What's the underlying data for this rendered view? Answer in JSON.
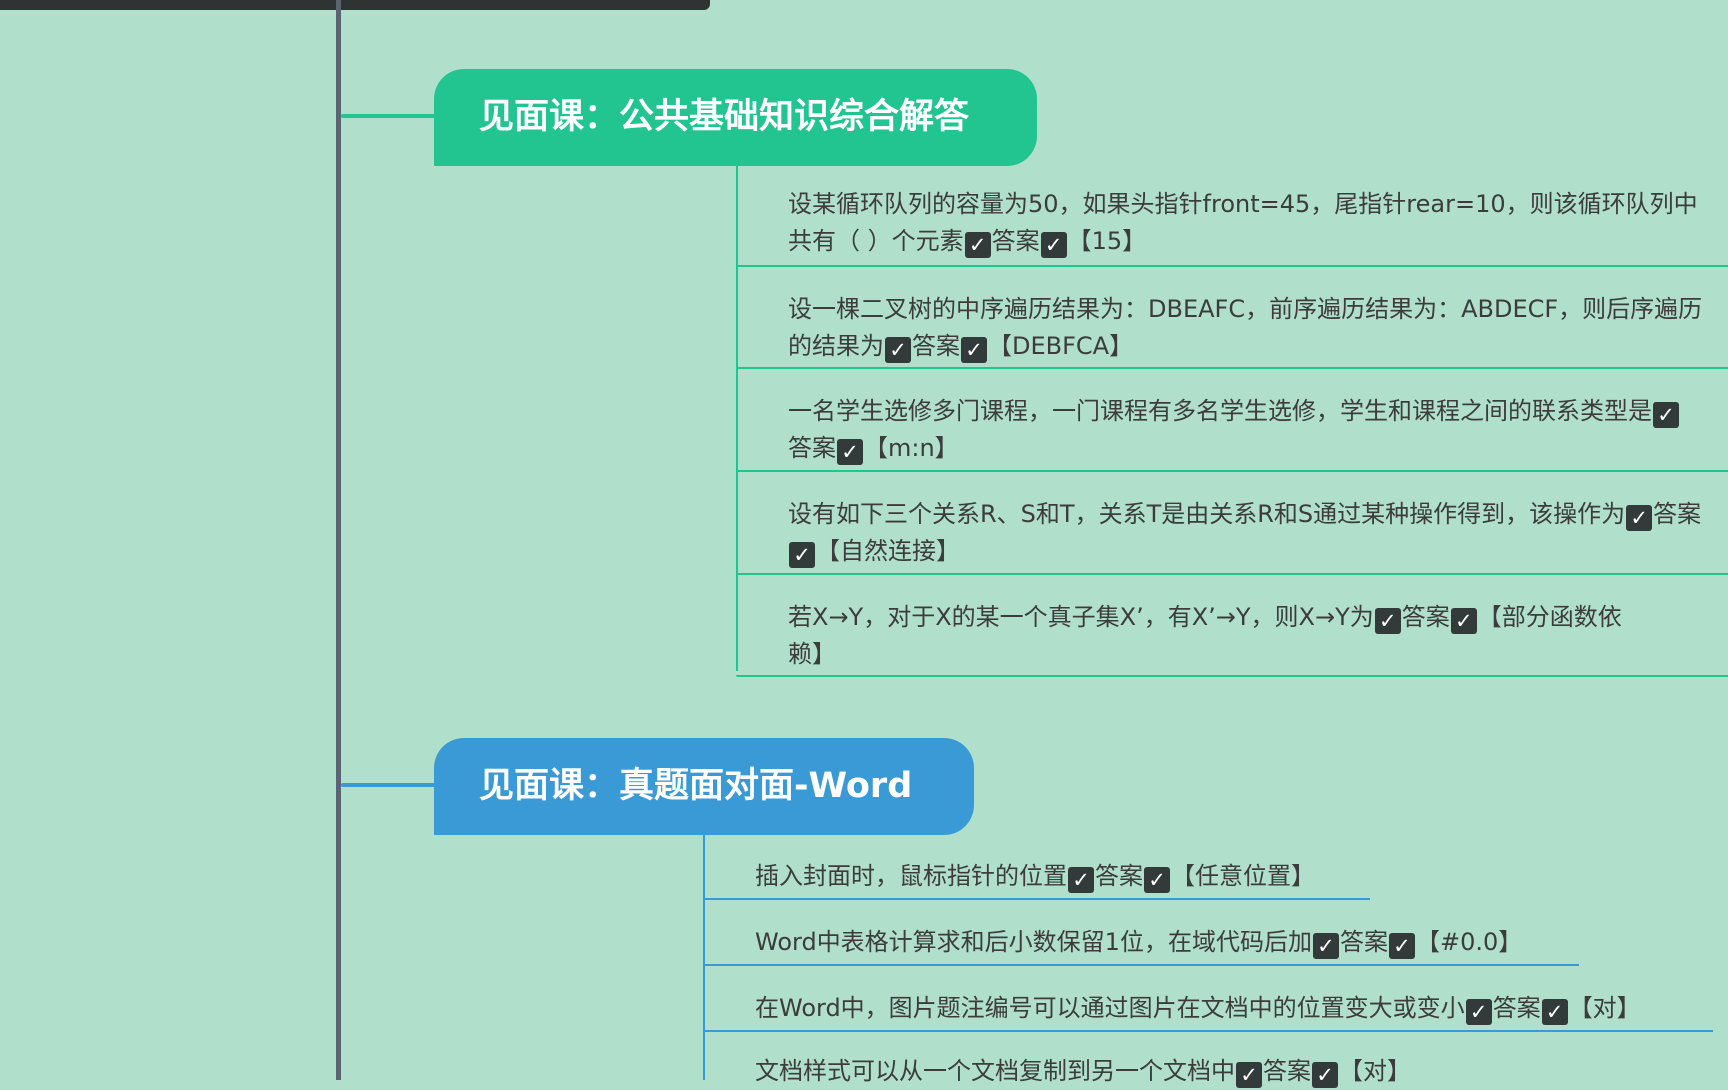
{
  "colors": {
    "background": "#b0dfcb",
    "spine": "#5a6572",
    "topic_green": "#22c58f",
    "topic_blue": "#3a9ad5",
    "check_box": "#333b3a"
  },
  "check_icon": "check-mark-icon",
  "answer_label": "答案",
  "topics": [
    {
      "title": "见面课：公共基础知识综合解答",
      "items": [
        {
          "line1": "设某循环队列的容量为50，如果头指针front=45，尾指针rear=10，则该循环队列中",
          "q2": "共有（ ）个元素",
          "answer": "【15】"
        },
        {
          "line1": "设一棵二叉树的中序遍历结果为：DBEAFC，前序遍历结果为：ABDECF，则后序遍历",
          "q2": "的结果为",
          "answer": "【DEBFCA】"
        },
        {
          "q1": "一名学生选修多门课程，一门课程有多名学生选修，学生和课程之间的联系类型是",
          "answer": "【m:n】"
        },
        {
          "q1": "设有如下三个关系R、S和T，关系T是由关系R和S通过某种操作得到，该操作为",
          "answer": "【自然连接】"
        },
        {
          "q1": "若X→Y，对于X的某一个真子集X’，有X’→Y，则X→Y为",
          "answer": "【部分函数依",
          "answer2": "赖】"
        }
      ]
    },
    {
      "title": "见面课：真题面对面-Word",
      "items": [
        {
          "question": "插入封面时，鼠标指针的位置",
          "answer": "【任意位置】"
        },
        {
          "question": "Word中表格计算求和后小数保留1位，在域代码后加",
          "answer": "【#0.0】"
        },
        {
          "question": "在Word中，图片题注编号可以通过图片在文档中的位置变大或变小",
          "answer": "【对】"
        },
        {
          "question": "文档样式可以从一个文档复制到另一个文档中",
          "answer": "【对】"
        }
      ]
    }
  ]
}
